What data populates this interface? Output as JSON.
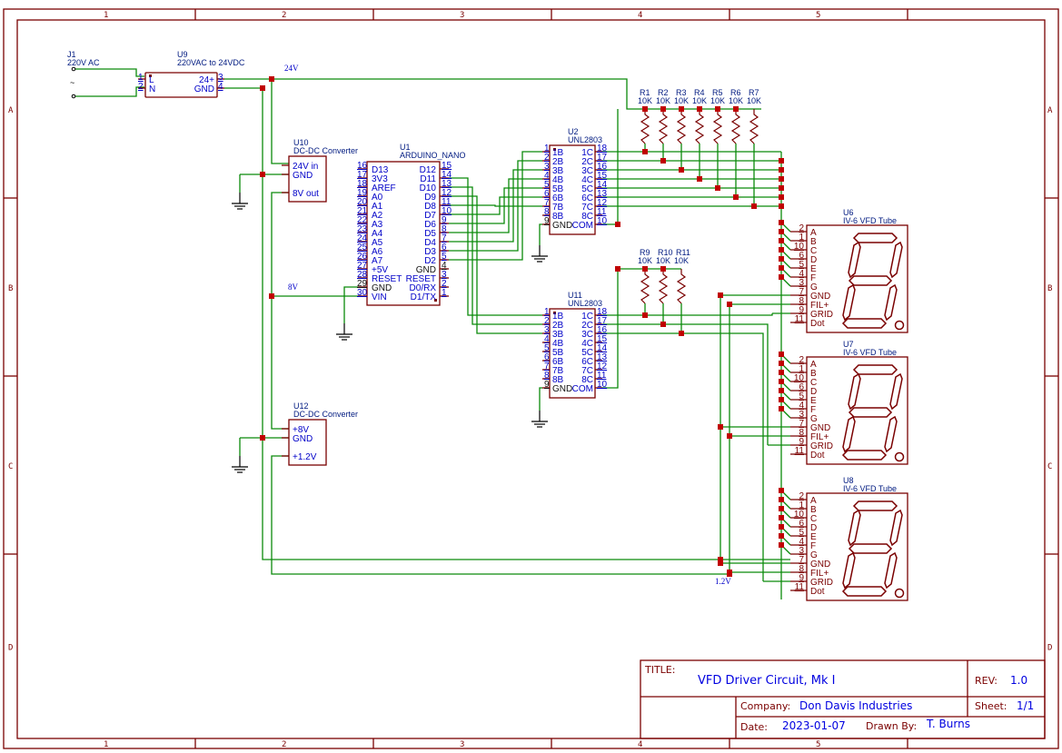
{
  "sheet": {
    "columns": [
      "1",
      "2",
      "3",
      "4",
      "5"
    ],
    "rows": [
      "A",
      "B",
      "C",
      "D"
    ]
  },
  "title_block": {
    "title_label": "TITLE:",
    "title": "VFD Driver Circuit, Mk I",
    "rev_label": "REV:",
    "rev": "1.0",
    "company_label": "Company:",
    "company": "Don Davis Industries",
    "sheet_label": "Sheet:",
    "sheet": "1/1",
    "date_label": "Date:",
    "date": "2023-01-07",
    "drawn_by_label": "Drawn By:",
    "drawn_by": "T. Burns"
  },
  "net_labels": {
    "v24": "24V",
    "v8": "8V",
    "v1_2": "1.2V"
  },
  "components": {
    "j1": {
      "ref": "J1",
      "value": "220V AC"
    },
    "u9": {
      "ref": "U9",
      "value": "220VAC to 24VDC",
      "left_pins": [
        {
          "num": "1",
          "name": "L"
        },
        {
          "num": "2",
          "name": "N"
        }
      ],
      "right_pins": [
        {
          "num": "3",
          "name": "24+"
        },
        {
          "num": "4",
          "name": "GND"
        }
      ]
    },
    "u10": {
      "ref": "U10",
      "value": "DC-DC Converter",
      "pins": [
        "24V in",
        "GND",
        "8V out"
      ]
    },
    "u12": {
      "ref": "U12",
      "value": "DC-DC Converter",
      "pins": [
        "+8V",
        "GND",
        "+1.2V"
      ]
    },
    "u1": {
      "ref": "U1",
      "value": "ARDUINO_NANO",
      "left_pins": [
        {
          "num": "16",
          "name": "D13"
        },
        {
          "num": "17",
          "name": "3V3"
        },
        {
          "num": "18",
          "name": "AREF"
        },
        {
          "num": "19",
          "name": "A0"
        },
        {
          "num": "20",
          "name": "A1"
        },
        {
          "num": "21",
          "name": "A2"
        },
        {
          "num": "22",
          "name": "A3"
        },
        {
          "num": "23",
          "name": "A4"
        },
        {
          "num": "24",
          "name": "A5"
        },
        {
          "num": "25",
          "name": "A6"
        },
        {
          "num": "26",
          "name": "A7"
        },
        {
          "num": "27",
          "name": "+5V"
        },
        {
          "num": "28",
          "name": "RESET"
        },
        {
          "num": "29",
          "name": "GND"
        },
        {
          "num": "30",
          "name": "VIN"
        }
      ],
      "right_pins": [
        {
          "num": "15",
          "name": "D12"
        },
        {
          "num": "14",
          "name": "D11"
        },
        {
          "num": "13",
          "name": "D10"
        },
        {
          "num": "12",
          "name": "D9"
        },
        {
          "num": "11",
          "name": "D8"
        },
        {
          "num": "10",
          "name": "D7"
        },
        {
          "num": "9",
          "name": "D6"
        },
        {
          "num": "8",
          "name": "D5"
        },
        {
          "num": "7",
          "name": "D4"
        },
        {
          "num": "6",
          "name": "D3"
        },
        {
          "num": "5",
          "name": "D2"
        },
        {
          "num": "4",
          "name": "GND"
        },
        {
          "num": "3",
          "name": "RESET"
        },
        {
          "num": "2",
          "name": "D0/RX"
        },
        {
          "num": "1",
          "name": "D1/TX"
        }
      ]
    },
    "u2": {
      "ref": "U2",
      "value": "UNL2803",
      "left_pins": [
        {
          "num": "1",
          "name": "1B"
        },
        {
          "num": "2",
          "name": "2B"
        },
        {
          "num": "3",
          "name": "3B"
        },
        {
          "num": "4",
          "name": "4B"
        },
        {
          "num": "5",
          "name": "5B"
        },
        {
          "num": "6",
          "name": "6B"
        },
        {
          "num": "7",
          "name": "7B"
        },
        {
          "num": "8",
          "name": "8B"
        },
        {
          "num": "9",
          "name": "GND"
        }
      ],
      "right_pins": [
        {
          "num": "18",
          "name": "1C"
        },
        {
          "num": "17",
          "name": "2C"
        },
        {
          "num": "16",
          "name": "3C"
        },
        {
          "num": "15",
          "name": "4C"
        },
        {
          "num": "14",
          "name": "5C"
        },
        {
          "num": "13",
          "name": "6C"
        },
        {
          "num": "12",
          "name": "7C"
        },
        {
          "num": "11",
          "name": "8C"
        },
        {
          "num": "10",
          "name": "COM"
        }
      ]
    },
    "u11": {
      "ref": "U11",
      "value": "UNL2803",
      "left_pins": [
        {
          "num": "1",
          "name": "1B"
        },
        {
          "num": "2",
          "name": "2B"
        },
        {
          "num": "3",
          "name": "3B"
        },
        {
          "num": "4",
          "name": "4B"
        },
        {
          "num": "5",
          "name": "5B"
        },
        {
          "num": "6",
          "name": "6B"
        },
        {
          "num": "7",
          "name": "7B"
        },
        {
          "num": "8",
          "name": "8B"
        },
        {
          "num": "9",
          "name": "GND"
        }
      ],
      "right_pins": [
        {
          "num": "18",
          "name": "1C"
        },
        {
          "num": "17",
          "name": "2C"
        },
        {
          "num": "16",
          "name": "3C"
        },
        {
          "num": "15",
          "name": "4C"
        },
        {
          "num": "14",
          "name": "5C"
        },
        {
          "num": "13",
          "name": "6C"
        },
        {
          "num": "12",
          "name": "7C"
        },
        {
          "num": "11",
          "name": "8C"
        },
        {
          "num": "10",
          "name": "COM"
        }
      ]
    },
    "resistors_top": [
      {
        "ref": "R1",
        "value": "10K"
      },
      {
        "ref": "R2",
        "value": "10K"
      },
      {
        "ref": "R3",
        "value": "10K"
      },
      {
        "ref": "R4",
        "value": "10K"
      },
      {
        "ref": "R5",
        "value": "10K"
      },
      {
        "ref": "R6",
        "value": "10K"
      },
      {
        "ref": "R7",
        "value": "10K"
      }
    ],
    "resistors_bottom": [
      {
        "ref": "R9",
        "value": "10K"
      },
      {
        "ref": "R10",
        "value": "10K"
      },
      {
        "ref": "R11",
        "value": "10K"
      }
    ],
    "vfd_tubes": [
      {
        "ref": "U6",
        "value": "IV-6 VFD Tube"
      },
      {
        "ref": "U7",
        "value": "IV-6 VFD Tube"
      },
      {
        "ref": "U8",
        "value": "IV-6 VFD Tube"
      }
    ],
    "vfd_pins": [
      {
        "num": "2",
        "name": "A"
      },
      {
        "num": "1",
        "name": "B"
      },
      {
        "num": "10",
        "name": "C"
      },
      {
        "num": "6",
        "name": "D"
      },
      {
        "num": "5",
        "name": "E"
      },
      {
        "num": "4",
        "name": "F"
      },
      {
        "num": "3",
        "name": "G"
      },
      {
        "num": "7",
        "name": "GND"
      },
      {
        "num": "8",
        "name": "FIL+"
      },
      {
        "num": "9",
        "name": "GRID"
      },
      {
        "num": "11",
        "name": "Dot"
      }
    ],
    "vfd_segment_letters": [
      "A",
      "B",
      "C",
      "D",
      "E",
      "F",
      "G",
      "DP"
    ]
  }
}
